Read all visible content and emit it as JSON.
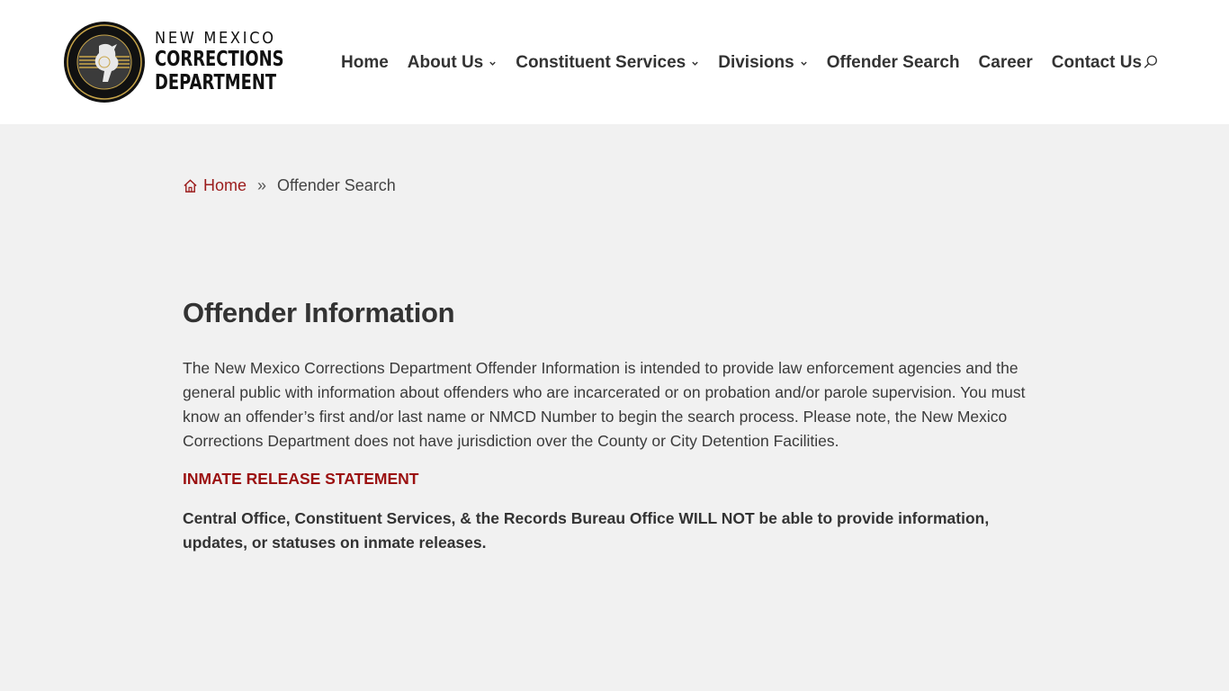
{
  "logo": {
    "line1": "NEW MEXICO",
    "line2": "CORRECTIONS",
    "line3": "DEPARTMENT",
    "seal_icon": "nmcd-seal-icon"
  },
  "nav": {
    "items": [
      {
        "label": "Home",
        "dropdown": false
      },
      {
        "label": "About Us",
        "dropdown": true
      },
      {
        "label": "Constituent Services",
        "dropdown": true
      },
      {
        "label": "Divisions",
        "dropdown": true
      },
      {
        "label": "Offender Search",
        "dropdown": false
      },
      {
        "label": "Career",
        "dropdown": false
      },
      {
        "label": "Contact Us",
        "dropdown": false
      }
    ],
    "search_icon": "search-icon"
  },
  "breadcrumb": {
    "home": "Home",
    "separator": "»",
    "current": "Offender Search"
  },
  "main": {
    "title": "Offender Information",
    "intro": "The New Mexico Corrections Department Offender Information is intended to provide law enforcement agencies and the general public with information about offenders who are incarcerated or on probation and/or parole supervision. You must know an offender’s first and/or last name or NMCD Number to begin the search process. Please note, the New Mexico Corrections Department does not have jurisdiction over the County or City Detention Facilities.",
    "statement_title": "INMATE RELEASE STATEMENT",
    "statement_body": "Central Office, Constituent Services, & the Records Bureau Office WILL NOT be able to provide information, updates, or statuses on inmate releases."
  },
  "colors": {
    "accent": "#9b1c1c",
    "background": "#f1f1f1",
    "header_bg": "#ffffff",
    "text": "#333333"
  }
}
